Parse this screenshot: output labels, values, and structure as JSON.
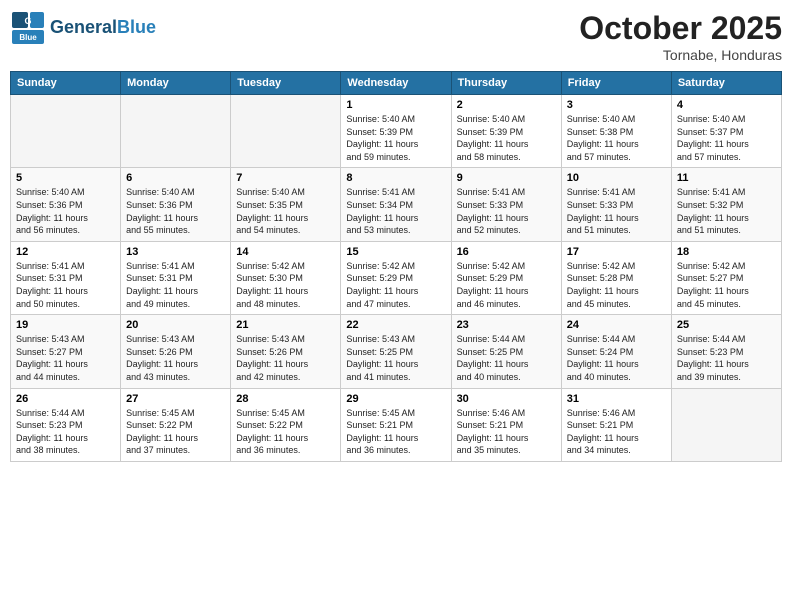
{
  "header": {
    "logo_general": "General",
    "logo_blue": "Blue",
    "month": "October 2025",
    "location": "Tornabe, Honduras"
  },
  "weekdays": [
    "Sunday",
    "Monday",
    "Tuesday",
    "Wednesday",
    "Thursday",
    "Friday",
    "Saturday"
  ],
  "weeks": [
    [
      {
        "day": "",
        "info": ""
      },
      {
        "day": "",
        "info": ""
      },
      {
        "day": "",
        "info": ""
      },
      {
        "day": "1",
        "info": "Sunrise: 5:40 AM\nSunset: 5:39 PM\nDaylight: 11 hours\nand 59 minutes."
      },
      {
        "day": "2",
        "info": "Sunrise: 5:40 AM\nSunset: 5:39 PM\nDaylight: 11 hours\nand 58 minutes."
      },
      {
        "day": "3",
        "info": "Sunrise: 5:40 AM\nSunset: 5:38 PM\nDaylight: 11 hours\nand 57 minutes."
      },
      {
        "day": "4",
        "info": "Sunrise: 5:40 AM\nSunset: 5:37 PM\nDaylight: 11 hours\nand 57 minutes."
      }
    ],
    [
      {
        "day": "5",
        "info": "Sunrise: 5:40 AM\nSunset: 5:36 PM\nDaylight: 11 hours\nand 56 minutes."
      },
      {
        "day": "6",
        "info": "Sunrise: 5:40 AM\nSunset: 5:36 PM\nDaylight: 11 hours\nand 55 minutes."
      },
      {
        "day": "7",
        "info": "Sunrise: 5:40 AM\nSunset: 5:35 PM\nDaylight: 11 hours\nand 54 minutes."
      },
      {
        "day": "8",
        "info": "Sunrise: 5:41 AM\nSunset: 5:34 PM\nDaylight: 11 hours\nand 53 minutes."
      },
      {
        "day": "9",
        "info": "Sunrise: 5:41 AM\nSunset: 5:33 PM\nDaylight: 11 hours\nand 52 minutes."
      },
      {
        "day": "10",
        "info": "Sunrise: 5:41 AM\nSunset: 5:33 PM\nDaylight: 11 hours\nand 51 minutes."
      },
      {
        "day": "11",
        "info": "Sunrise: 5:41 AM\nSunset: 5:32 PM\nDaylight: 11 hours\nand 51 minutes."
      }
    ],
    [
      {
        "day": "12",
        "info": "Sunrise: 5:41 AM\nSunset: 5:31 PM\nDaylight: 11 hours\nand 50 minutes."
      },
      {
        "day": "13",
        "info": "Sunrise: 5:41 AM\nSunset: 5:31 PM\nDaylight: 11 hours\nand 49 minutes."
      },
      {
        "day": "14",
        "info": "Sunrise: 5:42 AM\nSunset: 5:30 PM\nDaylight: 11 hours\nand 48 minutes."
      },
      {
        "day": "15",
        "info": "Sunrise: 5:42 AM\nSunset: 5:29 PM\nDaylight: 11 hours\nand 47 minutes."
      },
      {
        "day": "16",
        "info": "Sunrise: 5:42 AM\nSunset: 5:29 PM\nDaylight: 11 hours\nand 46 minutes."
      },
      {
        "day": "17",
        "info": "Sunrise: 5:42 AM\nSunset: 5:28 PM\nDaylight: 11 hours\nand 45 minutes."
      },
      {
        "day": "18",
        "info": "Sunrise: 5:42 AM\nSunset: 5:27 PM\nDaylight: 11 hours\nand 45 minutes."
      }
    ],
    [
      {
        "day": "19",
        "info": "Sunrise: 5:43 AM\nSunset: 5:27 PM\nDaylight: 11 hours\nand 44 minutes."
      },
      {
        "day": "20",
        "info": "Sunrise: 5:43 AM\nSunset: 5:26 PM\nDaylight: 11 hours\nand 43 minutes."
      },
      {
        "day": "21",
        "info": "Sunrise: 5:43 AM\nSunset: 5:26 PM\nDaylight: 11 hours\nand 42 minutes."
      },
      {
        "day": "22",
        "info": "Sunrise: 5:43 AM\nSunset: 5:25 PM\nDaylight: 11 hours\nand 41 minutes."
      },
      {
        "day": "23",
        "info": "Sunrise: 5:44 AM\nSunset: 5:25 PM\nDaylight: 11 hours\nand 40 minutes."
      },
      {
        "day": "24",
        "info": "Sunrise: 5:44 AM\nSunset: 5:24 PM\nDaylight: 11 hours\nand 40 minutes."
      },
      {
        "day": "25",
        "info": "Sunrise: 5:44 AM\nSunset: 5:23 PM\nDaylight: 11 hours\nand 39 minutes."
      }
    ],
    [
      {
        "day": "26",
        "info": "Sunrise: 5:44 AM\nSunset: 5:23 PM\nDaylight: 11 hours\nand 38 minutes."
      },
      {
        "day": "27",
        "info": "Sunrise: 5:45 AM\nSunset: 5:22 PM\nDaylight: 11 hours\nand 37 minutes."
      },
      {
        "day": "28",
        "info": "Sunrise: 5:45 AM\nSunset: 5:22 PM\nDaylight: 11 hours\nand 36 minutes."
      },
      {
        "day": "29",
        "info": "Sunrise: 5:45 AM\nSunset: 5:21 PM\nDaylight: 11 hours\nand 36 minutes."
      },
      {
        "day": "30",
        "info": "Sunrise: 5:46 AM\nSunset: 5:21 PM\nDaylight: 11 hours\nand 35 minutes."
      },
      {
        "day": "31",
        "info": "Sunrise: 5:46 AM\nSunset: 5:21 PM\nDaylight: 11 hours\nand 34 minutes."
      },
      {
        "day": "",
        "info": ""
      }
    ]
  ]
}
